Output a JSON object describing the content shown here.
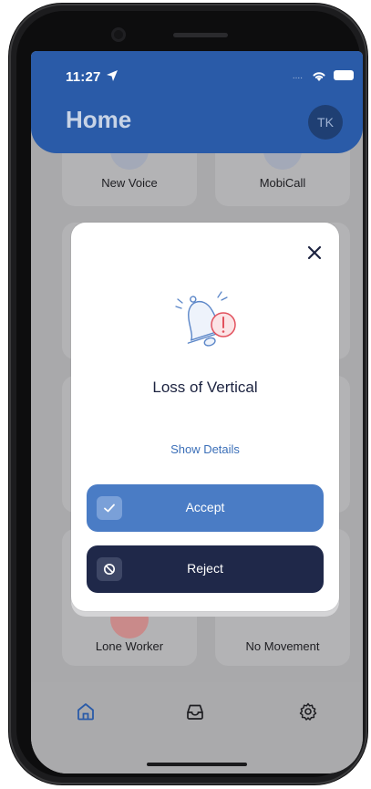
{
  "status_bar": {
    "time": "11:27",
    "location_icon": "location-arrow-icon",
    "signal_dots": "....",
    "wifi_icon": "wifi-icon",
    "battery_icon": "battery-icon"
  },
  "header": {
    "title": "Home",
    "avatar_initials": "TK",
    "color": "#2a5ba8"
  },
  "tiles": [
    {
      "label": "New Voice"
    },
    {
      "label": "MobiCall"
    },
    {
      "label": ""
    },
    {
      "label": ""
    },
    {
      "label": ""
    },
    {
      "label": ""
    },
    {
      "label": "Lone Worker"
    },
    {
      "label": "No Movement"
    }
  ],
  "bottom_nav": {
    "items": [
      {
        "icon": "home-icon",
        "active": true
      },
      {
        "icon": "inbox-icon",
        "active": false
      },
      {
        "icon": "settings-gear-icon",
        "active": false
      }
    ]
  },
  "modal": {
    "title": "Loss of Vertical",
    "details_link": "Show Details",
    "accept_label": "Accept",
    "reject_label": "Reject",
    "close_icon": "close-icon",
    "alert_icon": "bell-alert-icon",
    "colors": {
      "accept": "#4a7cc5",
      "reject": "#1f2849",
      "link": "#3b6fb8",
      "alert": "#e2515d"
    }
  }
}
